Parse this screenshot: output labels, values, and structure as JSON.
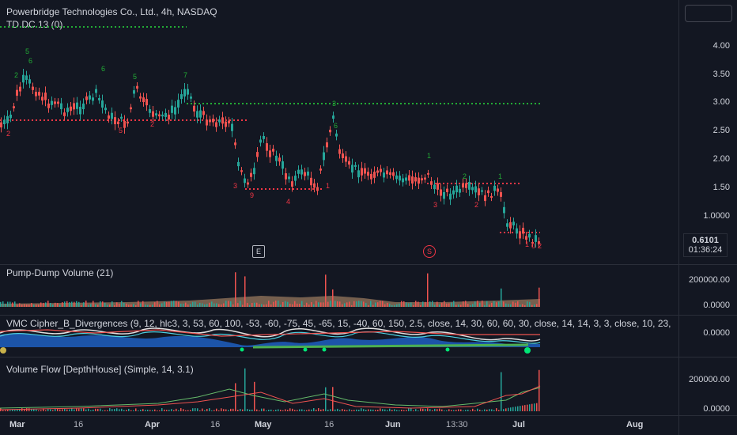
{
  "header": {
    "symbol_title": "Powerbridge Technologies Co., Ltd., 4h, NASDAQ",
    "indicator_label": "TD DC 13 (0)"
  },
  "main_pane": {
    "price_ticks": [
      "4.00",
      "3.50",
      "3.00",
      "2.50",
      "2.00",
      "1.50",
      "1.0000"
    ],
    "last_price": "0.6101",
    "countdown": "01:36:24",
    "event_markers": {
      "earnings": "E",
      "split": "S"
    },
    "colors": {
      "up": "#26a69a",
      "down": "#ef5350",
      "td_green": "#22ab35",
      "td_red": "#f23645"
    }
  },
  "panes": {
    "pump_dump": {
      "title": "Pump-Dump Volume (21)",
      "ticks": [
        "200000.00",
        "0.0000"
      ]
    },
    "wavetrend": {
      "title": "VMC Cipher_B_Divergences (9, 12, hlc3, 3, 53, 60, 100, -53, -60, -75, 45, -65, 15, -40, 60, 150, 2.5, close, 14, 30, 60, 60, 30, close, 14, 14, 3, 3, close, 10, 23,",
      "ticks": [
        "0.0000"
      ]
    },
    "volume_flow": {
      "title": "Volume Flow [DepthHouse] (Simple, 14, 3.1)",
      "ticks": [
        "200000.00",
        "0.0000"
      ]
    }
  },
  "x_axis": {
    "labels": [
      "Mar",
      "16",
      "Apr",
      "16",
      "May",
      "16",
      "Jun",
      "13:30",
      "Jul",
      "Aug"
    ]
  }
}
